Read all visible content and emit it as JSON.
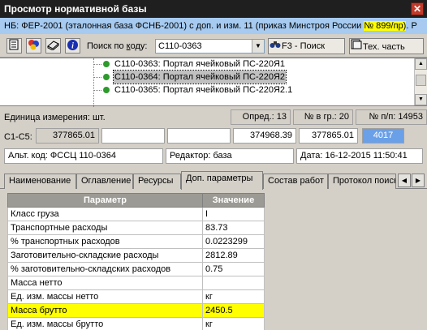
{
  "window": {
    "title": "Просмотр нормативной базы",
    "close_glyph": "✕"
  },
  "base": {
    "text": "НБ: ФЕР-2001 (эталонная база ФСНБ-2001) с доп. и изм. 11 (приказ Минстроя России ",
    "highlight": "№ 899/пр)",
    "suffix": ". Р"
  },
  "toolbar": {
    "search_label_pre": "Поиск по ",
    "search_label_u": "к",
    "search_label_post": "оду:",
    "search_value": "C110-0363",
    "f3_label": "F3 - Поиск",
    "tech_label": "Тех. часть"
  },
  "tree": {
    "items": [
      {
        "label": "C110-0363: Портал ячейковый ПС-220Я1",
        "selected": false
      },
      {
        "label": "C110-0364: Портал ячейковый ПС-220Я2",
        "selected": true
      },
      {
        "label": "C110-0365: Портал ячейковый ПС-220Я2.1",
        "selected": false
      }
    ]
  },
  "unit": {
    "label": "Единица измерения: шт.",
    "opred": "Опред.: 13",
    "nr_gr": "№ в гр.: 20",
    "nr_pp": "№ п/п: 14953"
  },
  "c1c5": {
    "label": "C1-C5:",
    "v1": "377865.01",
    "v2": "",
    "v3": "",
    "v4": "374968.39",
    "v5": "377865.01",
    "v6": "4017"
  },
  "alt": {
    "code": "Альт. код: ФССЦ 110-0364",
    "editor": "Редактор: база",
    "date": "Дата: 16-12-2015 11:50:41"
  },
  "tabs": [
    "Наименование",
    "Оглавление",
    "Ресурсы",
    "Доп. параметры",
    "Состав работ",
    "Протокол поиск"
  ],
  "active_tab": 3,
  "params": {
    "col_param": "Параметр",
    "col_value": "Значение",
    "rows": [
      {
        "name": "Класс груза",
        "value": "I"
      },
      {
        "name": "Транспортные расходы",
        "value": "83.73"
      },
      {
        "name": "% транспортных расходов",
        "value": "0.0223299"
      },
      {
        "name": "Заготовительно-складские расходы",
        "value": "2812.89"
      },
      {
        "name": "% заготовительно-складских расходов",
        "value": "0.75"
      },
      {
        "name": "Масса нетто",
        "value": ""
      },
      {
        "name": "Ед. изм. массы нетто",
        "value": "кг"
      },
      {
        "name": "Масса брутто",
        "value": "2450.5"
      },
      {
        "name": "Ед. изм. массы брутто",
        "value": "кг"
      }
    ],
    "highlight_row": 7
  },
  "colors": {
    "highlight": "#ffff00",
    "accent_blue": "#6aa0e8"
  }
}
